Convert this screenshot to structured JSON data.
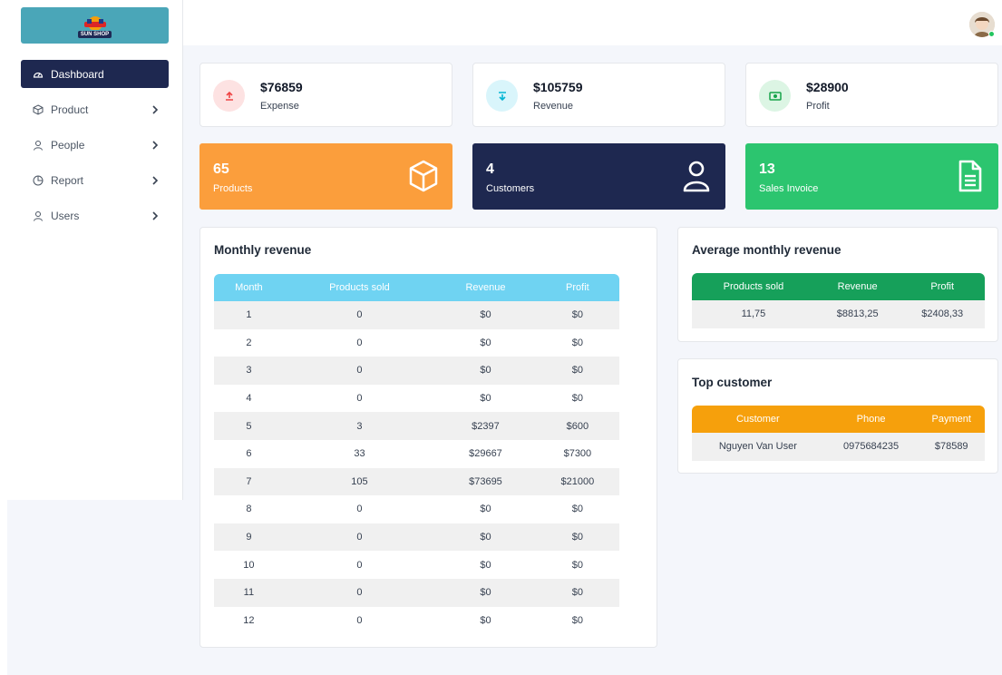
{
  "brand": {
    "logo_text": "SUN SHOP"
  },
  "sidebar": {
    "items": [
      {
        "label": "Dashboard",
        "icon": "gauge-icon",
        "active": true
      },
      {
        "label": "Product",
        "icon": "box-icon",
        "active": false
      },
      {
        "label": "People",
        "icon": "person-icon",
        "active": false
      },
      {
        "label": "Report",
        "icon": "pie-chart-icon",
        "active": false
      },
      {
        "label": "Users",
        "icon": "person-icon",
        "active": false
      }
    ]
  },
  "stats": [
    {
      "value": "$76859",
      "label": "Expense",
      "icon": "upload-icon",
      "color": "#ef4444",
      "bg": "#fde2e2"
    },
    {
      "value": "$105759",
      "label": "Revenue",
      "icon": "download-icon",
      "color": "#06b6d4",
      "bg": "#d9f5fb"
    },
    {
      "value": "$28900",
      "label": "Profit",
      "icon": "cash-icon",
      "color": "#16a34a",
      "bg": "#dcf5e4"
    }
  ],
  "summary_cards": [
    {
      "value": "65",
      "label": "Products",
      "icon": "cube-icon",
      "color": "#fb9e3c"
    },
    {
      "value": "4",
      "label": "Customers",
      "icon": "user-icon",
      "color": "#1e2850"
    },
    {
      "value": "13",
      "label": "Sales Invoice",
      "icon": "document-icon",
      "color": "#2cc56f"
    }
  ],
  "monthly_revenue": {
    "title": "Monthly revenue",
    "columns": [
      "Month",
      "Products sold",
      "Revenue",
      "Profit"
    ],
    "rows": [
      [
        "1",
        "0",
        "$0",
        "$0"
      ],
      [
        "2",
        "0",
        "$0",
        "$0"
      ],
      [
        "3",
        "0",
        "$0",
        "$0"
      ],
      [
        "4",
        "0",
        "$0",
        "$0"
      ],
      [
        "5",
        "3",
        "$2397",
        "$600"
      ],
      [
        "6",
        "33",
        "$29667",
        "$7300"
      ],
      [
        "7",
        "105",
        "$73695",
        "$21000"
      ],
      [
        "8",
        "0",
        "$0",
        "$0"
      ],
      [
        "9",
        "0",
        "$0",
        "$0"
      ],
      [
        "10",
        "0",
        "$0",
        "$0"
      ],
      [
        "11",
        "0",
        "$0",
        "$0"
      ],
      [
        "12",
        "0",
        "$0",
        "$0"
      ]
    ]
  },
  "average_monthly_revenue": {
    "title": "Average monthly revenue",
    "columns": [
      "Products sold",
      "Revenue",
      "Profit"
    ],
    "rows": [
      [
        "11,75",
        "$8813,25",
        "$2408,33"
      ]
    ]
  },
  "top_customer": {
    "title": "Top customer",
    "columns": [
      "Customer",
      "Phone",
      "Payment"
    ],
    "rows": [
      [
        "Nguyen Van User",
        "0975684235",
        "$78589"
      ]
    ]
  }
}
